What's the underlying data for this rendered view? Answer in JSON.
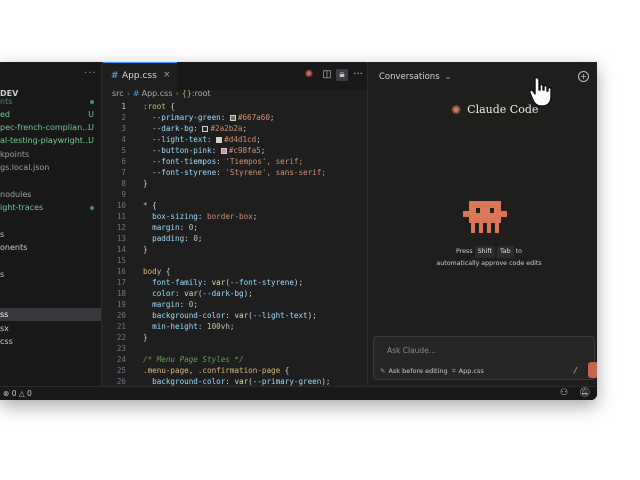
{
  "sidebar": {
    "title": "DEV",
    "more_icon": "ellipsis-icon",
    "items": [
      {
        "label": "nts",
        "color": "#3e8f6a",
        "badge": "dot"
      },
      {
        "label": "ed",
        "color": "#73c991",
        "badge": "U"
      },
      {
        "label": "pec-french-complian...",
        "color": "#73c991",
        "badge": "U"
      },
      {
        "label": "al-testing-playwright...",
        "color": "#73c991",
        "badge": "U"
      },
      {
        "label": "kpoints",
        "color": "#a0a0a0",
        "badge": ""
      },
      {
        "label": "gs.local.json",
        "color": "#a0a0a0",
        "badge": ""
      },
      {
        "label": "",
        "color": "#a0a0a0",
        "badge": ""
      },
      {
        "label": "nodules",
        "color": "#a0a0a0",
        "badge": ""
      },
      {
        "label": "ight-traces",
        "color": "#73c991",
        "badge": "dot"
      },
      {
        "label": "",
        "color": "#a0a0a0",
        "badge": ""
      },
      {
        "label": "s",
        "color": "#cccccc",
        "badge": ""
      },
      {
        "label": "onents",
        "color": "#cccccc",
        "badge": ""
      },
      {
        "label": "",
        "color": "#cccccc",
        "badge": ""
      },
      {
        "label": "s",
        "color": "#cccccc",
        "badge": ""
      },
      {
        "label": "",
        "color": "#cccccc",
        "badge": ""
      },
      {
        "label": "",
        "color": "#cccccc",
        "badge": ""
      },
      {
        "label": "ss",
        "color": "#ffffff",
        "badge": "",
        "selected": true
      },
      {
        "label": "sx",
        "color": "#cccccc",
        "badge": ""
      },
      {
        "label": "css",
        "color": "#cccccc",
        "badge": ""
      },
      {
        "label": "",
        "color": "#cccccc",
        "badge": ""
      }
    ]
  },
  "editor": {
    "tab": {
      "icon": "#",
      "label": "App.css",
      "close": "×"
    },
    "toolbar_icons": [
      "bug-icon",
      "split-editor-icon",
      "lock-icon",
      "ellipsis-icon"
    ],
    "breadcrumb": {
      "folder": "src",
      "file": "App.css",
      "symbol_icon": "{}",
      "symbol": ":root"
    },
    "current_line": 1,
    "lines": [
      {
        "n": "1",
        "parts": [
          [
            ":root",
            "sel"
          ],
          [
            " {",
            "pun"
          ]
        ]
      },
      {
        "n": "2",
        "parts": [
          [
            "  --primary-green",
            "var"
          ],
          [
            ": ",
            "pun"
          ],
          [
            "#667a60",
            "val",
            "#667a60"
          ],
          [
            ";",
            "pun"
          ]
        ]
      },
      {
        "n": "3",
        "parts": [
          [
            "  --dark-bg",
            "var"
          ],
          [
            ": ",
            "pun"
          ],
          [
            "#2a2b2a",
            "val",
            "#2a2b2a"
          ],
          [
            ";",
            "pun"
          ]
        ]
      },
      {
        "n": "4",
        "parts": [
          [
            "  --light-text",
            "var"
          ],
          [
            ": ",
            "pun"
          ],
          [
            "#d4d1cd",
            "val",
            "#d4d1cd"
          ],
          [
            ";",
            "pun"
          ]
        ]
      },
      {
        "n": "5",
        "parts": [
          [
            "  --button-pink",
            "var"
          ],
          [
            ": ",
            "pun"
          ],
          [
            "#c98fa5",
            "val",
            "#c98fa5"
          ],
          [
            ";",
            "pun"
          ]
        ]
      },
      {
        "n": "6",
        "parts": [
          [
            "  --font-tiempos",
            "var"
          ],
          [
            ": ",
            "pun"
          ],
          [
            "'Tiempos'",
            "val"
          ],
          [
            ", serif;",
            "val"
          ]
        ]
      },
      {
        "n": "7",
        "parts": [
          [
            "  --font-styrene",
            "var"
          ],
          [
            ": ",
            "pun"
          ],
          [
            "'Styrene'",
            "val"
          ],
          [
            ", sans-serif;",
            "val"
          ]
        ]
      },
      {
        "n": "8",
        "parts": [
          [
            "}",
            "pun"
          ]
        ]
      },
      {
        "n": "9",
        "parts": []
      },
      {
        "n": "10",
        "parts": [
          [
            "* ",
            "sel"
          ],
          [
            "{",
            "pun"
          ]
        ]
      },
      {
        "n": "11",
        "parts": [
          [
            "  box-sizing",
            "prop"
          ],
          [
            ": ",
            "pun"
          ],
          [
            "border-box",
            "val"
          ],
          [
            ";",
            "pun"
          ]
        ]
      },
      {
        "n": "12",
        "parts": [
          [
            "  margin",
            "prop"
          ],
          [
            ": ",
            "pun"
          ],
          [
            "0",
            "num"
          ],
          [
            ";",
            "pun"
          ]
        ]
      },
      {
        "n": "13",
        "parts": [
          [
            "  padding",
            "prop"
          ],
          [
            ": ",
            "pun"
          ],
          [
            "0",
            "num"
          ],
          [
            ";",
            "pun"
          ]
        ]
      },
      {
        "n": "14",
        "parts": [
          [
            "}",
            "pun"
          ]
        ]
      },
      {
        "n": "15",
        "parts": []
      },
      {
        "n": "16",
        "parts": [
          [
            "body",
            "sel"
          ],
          [
            " {",
            "pun"
          ]
        ]
      },
      {
        "n": "17",
        "parts": [
          [
            "  font-family",
            "prop"
          ],
          [
            ": ",
            "pun"
          ],
          [
            "var",
            "fn"
          ],
          [
            "(",
            "pun"
          ],
          [
            "--font-styrene",
            "var"
          ],
          [
            ");",
            "pun"
          ]
        ]
      },
      {
        "n": "18",
        "parts": [
          [
            "  color",
            "prop"
          ],
          [
            ": ",
            "pun"
          ],
          [
            "var",
            "fn"
          ],
          [
            "(",
            "pun"
          ],
          [
            "--dark-bg",
            "var"
          ],
          [
            ");",
            "pun"
          ]
        ]
      },
      {
        "n": "19",
        "parts": [
          [
            "  margin",
            "prop"
          ],
          [
            ": ",
            "pun"
          ],
          [
            "0",
            "num"
          ],
          [
            ";",
            "pun"
          ]
        ]
      },
      {
        "n": "20",
        "parts": [
          [
            "  background-color",
            "prop"
          ],
          [
            ": ",
            "pun"
          ],
          [
            "var",
            "fn"
          ],
          [
            "(",
            "pun"
          ],
          [
            "--light-text",
            "var"
          ],
          [
            ");",
            "pun"
          ]
        ]
      },
      {
        "n": "21",
        "parts": [
          [
            "  min-height",
            "prop"
          ],
          [
            ": ",
            "pun"
          ],
          [
            "100vh",
            "num"
          ],
          [
            ";",
            "pun"
          ]
        ]
      },
      {
        "n": "22",
        "parts": [
          [
            "}",
            "pun"
          ]
        ]
      },
      {
        "n": "23",
        "parts": []
      },
      {
        "n": "24",
        "parts": [
          [
            "/* Menu Page Styles */",
            "com"
          ]
        ]
      },
      {
        "n": "25",
        "parts": [
          [
            ".menu-page, .confirmation-page",
            "sel"
          ],
          [
            " {",
            "pun"
          ]
        ]
      },
      {
        "n": "26",
        "parts": [
          [
            "  background-color",
            "prop"
          ],
          [
            ": ",
            "pun"
          ],
          [
            "var",
            "fn"
          ],
          [
            "(",
            "pun"
          ],
          [
            "--primary-green",
            "var"
          ],
          [
            ");",
            "pun"
          ]
        ]
      }
    ]
  },
  "panel": {
    "header": "Conversations",
    "header_icon": "chevron-down-icon",
    "new_icon": "new-chat-icon",
    "brand_name": "Claude Code",
    "brand_color": "#d97757",
    "hint_before": "Press",
    "hint_key1": "Shift",
    "hint_key2": "Tab",
    "hint_after": "to automatically approve code edits",
    "input_placeholder": "Ask Claude...",
    "mode_label": "Ask before editing",
    "file_label": "App.css",
    "slash": "/"
  },
  "status": {
    "errors": "0",
    "warnings": "0"
  }
}
